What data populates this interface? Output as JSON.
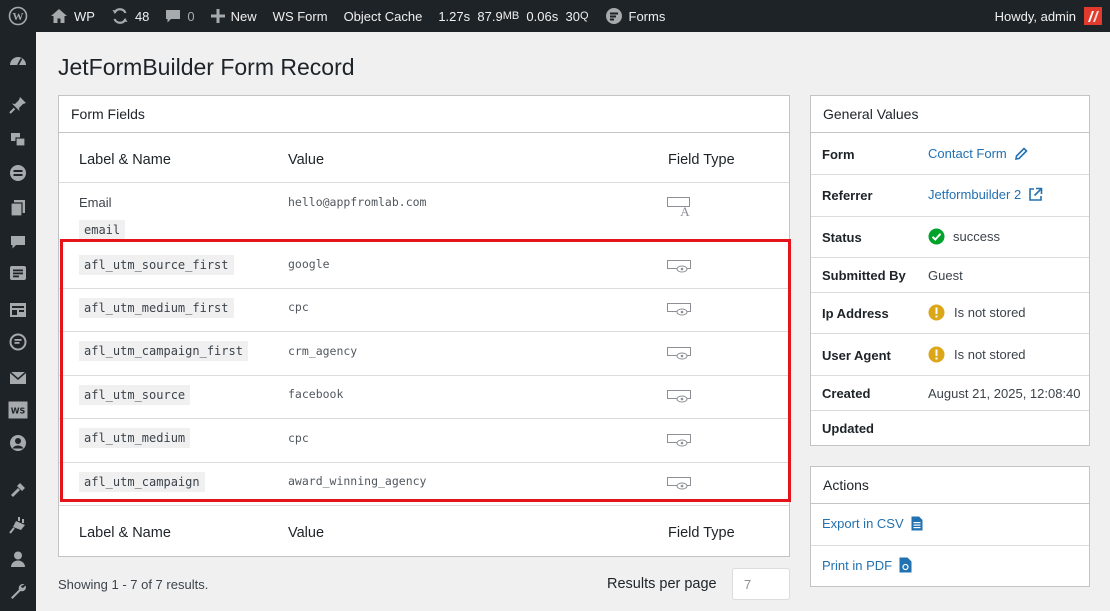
{
  "adminbar": {
    "site_name": "WP",
    "updates_count": "48",
    "comments_count": "0",
    "new_label": "New",
    "ws_form_label": "WS Form",
    "object_cache_label": "Object Cache",
    "perf_time": "1.27s",
    "perf_mem": "87.9",
    "perf_mem_unit": "MB",
    "perf_db_time": "0.06s",
    "perf_queries": "30",
    "perf_queries_unit": "Q",
    "forms_label": "Forms",
    "howdy": "Howdy, admin"
  },
  "page": {
    "title": "JetFormBuilder Form Record"
  },
  "form_fields": {
    "panel_title": "Form Fields",
    "col_label": "Label & Name",
    "col_value": "Value",
    "col_type": "Field Type",
    "rows": [
      {
        "label": "Email",
        "name": "email",
        "value": "hello@appfromlab.com",
        "type_icon": "text-field-icon"
      },
      {
        "label": "",
        "name": "afl_utm_source_first",
        "value": "google",
        "type_icon": "hidden-field-icon"
      },
      {
        "label": "",
        "name": "afl_utm_medium_first",
        "value": "cpc",
        "type_icon": "hidden-field-icon"
      },
      {
        "label": "",
        "name": "afl_utm_campaign_first",
        "value": "crm_agency",
        "type_icon": "hidden-field-icon"
      },
      {
        "label": "",
        "name": "afl_utm_source",
        "value": "facebook",
        "type_icon": "hidden-field-icon"
      },
      {
        "label": "",
        "name": "afl_utm_medium",
        "value": "cpc",
        "type_icon": "hidden-field-icon"
      },
      {
        "label": "",
        "name": "afl_utm_campaign",
        "value": "award_winning_agency",
        "type_icon": "hidden-field-icon"
      }
    ]
  },
  "general": {
    "panel_title": "General Values",
    "form_label": "Form",
    "form_value": "Contact Form",
    "referrer_label": "Referrer",
    "referrer_value": "Jetformbuilder 2",
    "status_label": "Status",
    "status_value": "success",
    "submitted_label": "Submitted By",
    "submitted_value": "Guest",
    "ip_label": "Ip Address",
    "ip_value": "Is not stored",
    "agent_label": "User Agent",
    "agent_value": "Is not stored",
    "created_label": "Created",
    "created_value": "August 21, 2025, 12:08:40",
    "updated_label": "Updated",
    "updated_value": ""
  },
  "actions": {
    "panel_title": "Actions",
    "export_csv": "Export in CSV",
    "print_pdf": "Print in PDF"
  },
  "footer": {
    "showing": "Showing 1 - 7 of 7 results.",
    "results_per_page_label": "Results per page",
    "results_per_page_value": "7"
  },
  "colors": {
    "adminbar_bg": "#1d2327",
    "link": "#2271b1",
    "success": "#00a32a",
    "warning": "#dba617",
    "highlight": "#e5141b"
  }
}
